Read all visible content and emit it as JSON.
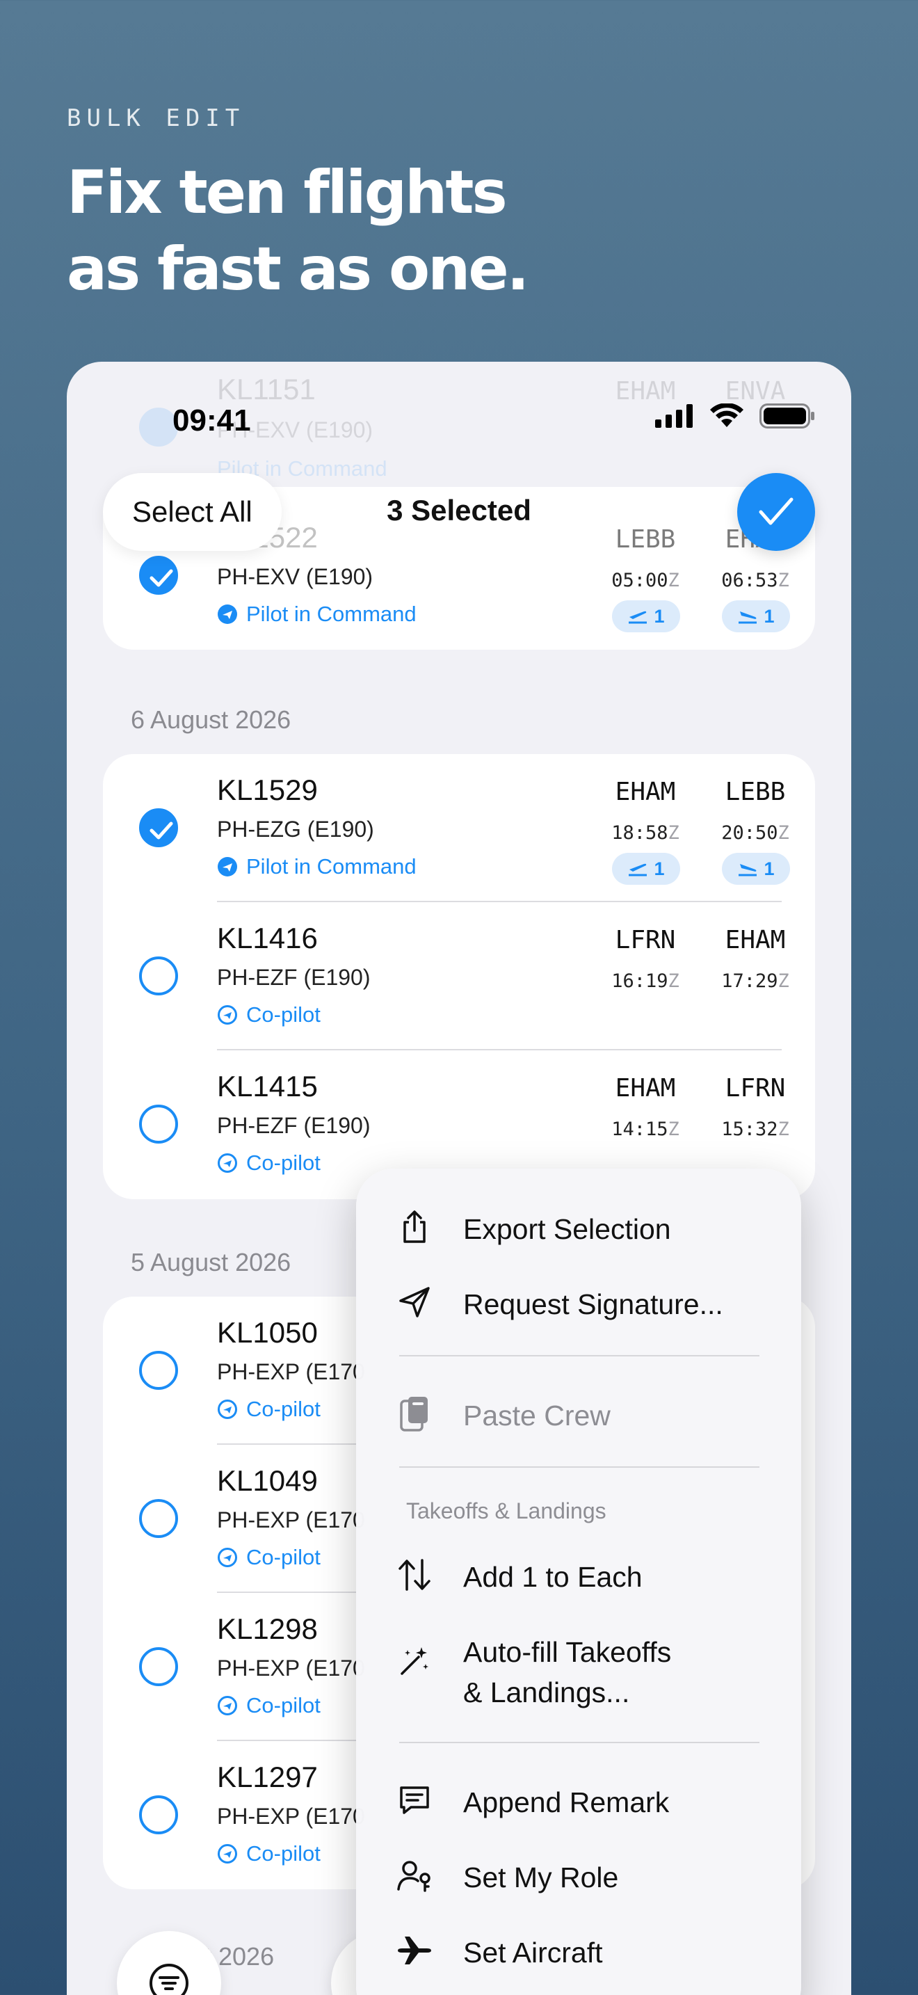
{
  "hero": {
    "eyebrow": "BULK EDIT",
    "headline_line1": "Fix ten flights",
    "headline_line2": "as fast as one."
  },
  "status_bar": {
    "time": "09:41"
  },
  "nav": {
    "select_all_label": "Select All",
    "title": "3 Selected"
  },
  "ghost_row": {
    "flight": "KL1151",
    "registration": "PH-EXV (E190)",
    "role": "Pilot in Command",
    "from": "EHAM",
    "to": "ENVA"
  },
  "top_group": [
    {
      "flight": "KL1522",
      "registration": "PH-EXV (E190)",
      "role": "Pilot in Command",
      "from": "LEBB",
      "to": "EHAM",
      "dep": "05:00",
      "arr": "06:53",
      "takeoffs": "1",
      "landings": "1",
      "selected": true
    }
  ],
  "sections": [
    {
      "date": "6 August 2026",
      "rows": [
        {
          "flight": "KL1529",
          "registration": "PH-EZG (E190)",
          "role": "Pilot in Command",
          "from": "EHAM",
          "to": "LEBB",
          "dep": "18:58",
          "arr": "20:50",
          "takeoffs": "1",
          "landings": "1",
          "selected": true
        },
        {
          "flight": "KL1416",
          "registration": "PH-EZF (E190)",
          "role": "Co-pilot",
          "from": "LFRN",
          "to": "EHAM",
          "dep": "16:19",
          "arr": "17:29",
          "selected": false
        },
        {
          "flight": "KL1415",
          "registration": "PH-EZF (E190)",
          "role": "Co-pilot",
          "from": "EHAM",
          "to": "LFRN",
          "dep": "14:15",
          "arr": "15:32",
          "selected": false
        }
      ]
    },
    {
      "date": "5 August 2026",
      "rows": [
        {
          "flight": "KL1050",
          "registration": "PH-EXP (E170",
          "role": "Co-pilot",
          "selected": false
        },
        {
          "flight": "KL1049",
          "registration": "PH-EXP (E170",
          "role": "Co-pilot",
          "selected": false
        },
        {
          "flight": "KL1298",
          "registration": "PH-EXP (E170",
          "role": "Co-pilot",
          "selected": false
        },
        {
          "flight": "KL1297",
          "registration": "PH-EXP (E170",
          "role": "Co-pilot",
          "selected": false
        }
      ]
    }
  ],
  "next_section_partial": "st 2026",
  "zulu_suffix": "Z",
  "context_menu": {
    "export": "Export Selection",
    "request_signature": "Request Signature...",
    "paste_crew": "Paste Crew",
    "section_takeoffs": "Takeoffs & Landings",
    "add_one": "Add 1 to Each",
    "autofill_line1": "Auto-fill Takeoffs",
    "autofill_line2": "& Landings...",
    "append_remark": "Append Remark",
    "set_role": "Set My Role",
    "set_aircraft": "Set Aircraft"
  },
  "colors": {
    "accent": "#1a8cf5",
    "badge_bg": "#dcebfb",
    "screen_bg": "#f1f1f6"
  }
}
